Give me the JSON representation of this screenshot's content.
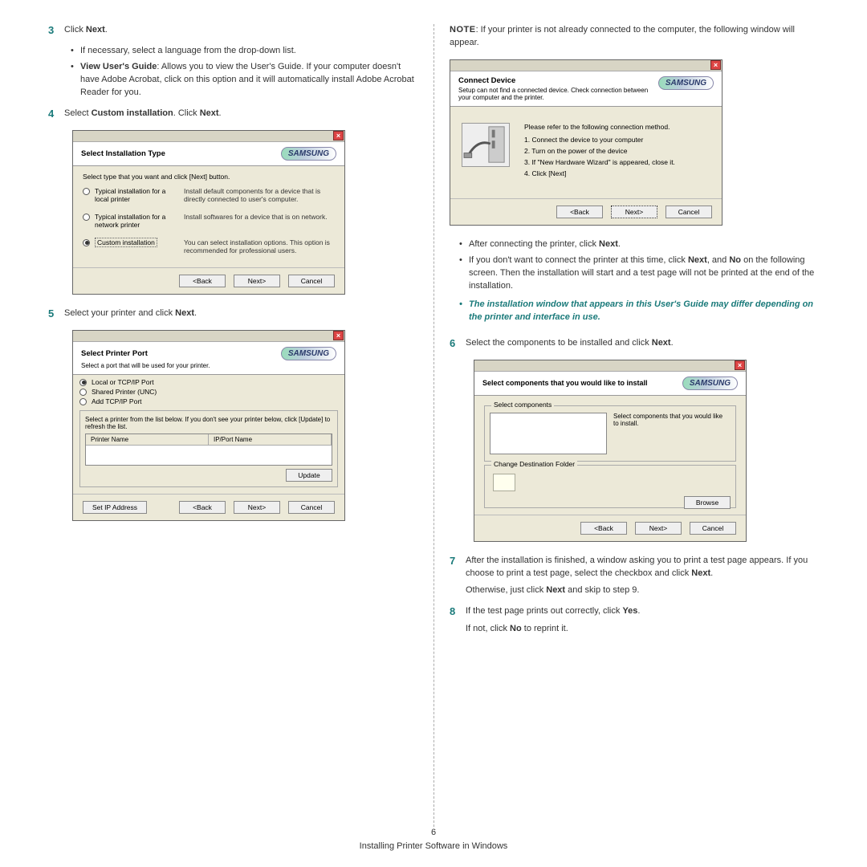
{
  "page_number": "6",
  "page_title": "Installing Printer Software in Windows",
  "left": {
    "step3": {
      "num": "3",
      "text_a": "Click ",
      "text_b": "Next",
      "text_c": ".",
      "b1": "If necessary, select a language from the drop-down list.",
      "b2_a": "View User's Guide",
      "b2_b": ": Allows you to view the User's Guide. If your computer doesn't have Adobe Acrobat, click on this option and it will automatically install Adobe Acrobat Reader for you."
    },
    "step4": {
      "num": "4",
      "text_a": "Select ",
      "text_b": "Custom installation",
      "text_c": ". Click ",
      "text_d": "Next",
      "text_e": "."
    },
    "mock1": {
      "title": "Select Installation Type",
      "instr": "Select type that you want and click [Next] button.",
      "r1_label": "Typical installation for a local printer",
      "r1_desc": "Install default components for a device that is directly connected to user's computer.",
      "r2_label": "Typical installation for a network printer",
      "r2_desc": "Install softwares for a device that is on network.",
      "r3_label": "Custom installation",
      "r3_desc": "You can select installation options. This option is recommended for professional users.",
      "back": "<Back",
      "next": "Next>",
      "cancel": "Cancel",
      "logo": "SAMSUNG"
    },
    "step5": {
      "num": "5",
      "text_a": "Select your printer and click ",
      "text_b": "Next",
      "text_c": "."
    },
    "mock2": {
      "title": "Select Printer Port",
      "sub": "Select a port that will be used for your printer.",
      "opt1": "Local or TCP/IP Port",
      "opt2": "Shared Printer (UNC)",
      "opt3": "Add TCP/IP Port",
      "instr": "Select a printer from the list below. If you don't see your printer below, click [Update] to refresh the list.",
      "col1": "Printer Name",
      "col2": "IP/Port Name",
      "update": "Update",
      "setip": "Set IP Address",
      "back": "<Back",
      "next": "Next>",
      "cancel": "Cancel",
      "logo": "SAMSUNG"
    }
  },
  "right": {
    "note": {
      "label": "NOTE",
      "text": ": If your printer is not already connected to the computer, the following window will appear."
    },
    "mock3": {
      "title": "Connect Device",
      "sub": "Setup can not find a connected device. Check connection between your computer and the printer.",
      "lead": "Please refer to the following connection method.",
      "l1": "1. Connect the device to your computer",
      "l2": "2. Turn on the power of the device",
      "l3": "3. If \"New Hardware Wizard\" is appeared, close it.",
      "l4": "4. Click [Next]",
      "back": "<Back",
      "next": "Next>",
      "cancel": "Cancel",
      "logo": "SAMSUNG"
    },
    "b1_a": "After connecting the printer, click ",
    "b1_b": "Next",
    "b1_c": ".",
    "b2_a": "If you don't want to connect the printer at this time, click ",
    "b2_b": "Next",
    "b2_c": ", and ",
    "b2_d": "No",
    "b2_e": " on the following screen. Then the installation will start and a test page will not be printed at the end of the installation.",
    "italic": "The installation window that appears in this User's Guide may differ depending on the printer and interface in use.",
    "step6": {
      "num": "6",
      "text_a": "Select the components to be installed and click ",
      "text_b": "Next",
      "text_c": "."
    },
    "mock4": {
      "title": "Select components that you would like to install",
      "g1": "Select components",
      "g1desc": "Select components that you would like to install.",
      "g2": "Change Destination Folder",
      "browse": "Browse",
      "back": "<Back",
      "next": "Next>",
      "cancel": "Cancel",
      "logo": "SAMSUNG"
    },
    "step7": {
      "num": "7",
      "p1_a": "After the installation is finished, a window asking you to print a test page appears. If you choose to print a test page, select the checkbox and click ",
      "p1_b": "Next",
      "p1_c": ".",
      "p2_a": "Otherwise, just click ",
      "p2_b": "Next",
      "p2_c": " and skip to step 9."
    },
    "step8": {
      "num": "8",
      "p1_a": "If the test page prints out correctly, click ",
      "p1_b": "Yes",
      "p1_c": ".",
      "p2_a": "If not, click ",
      "p2_b": "No",
      "p2_c": " to reprint it."
    }
  }
}
